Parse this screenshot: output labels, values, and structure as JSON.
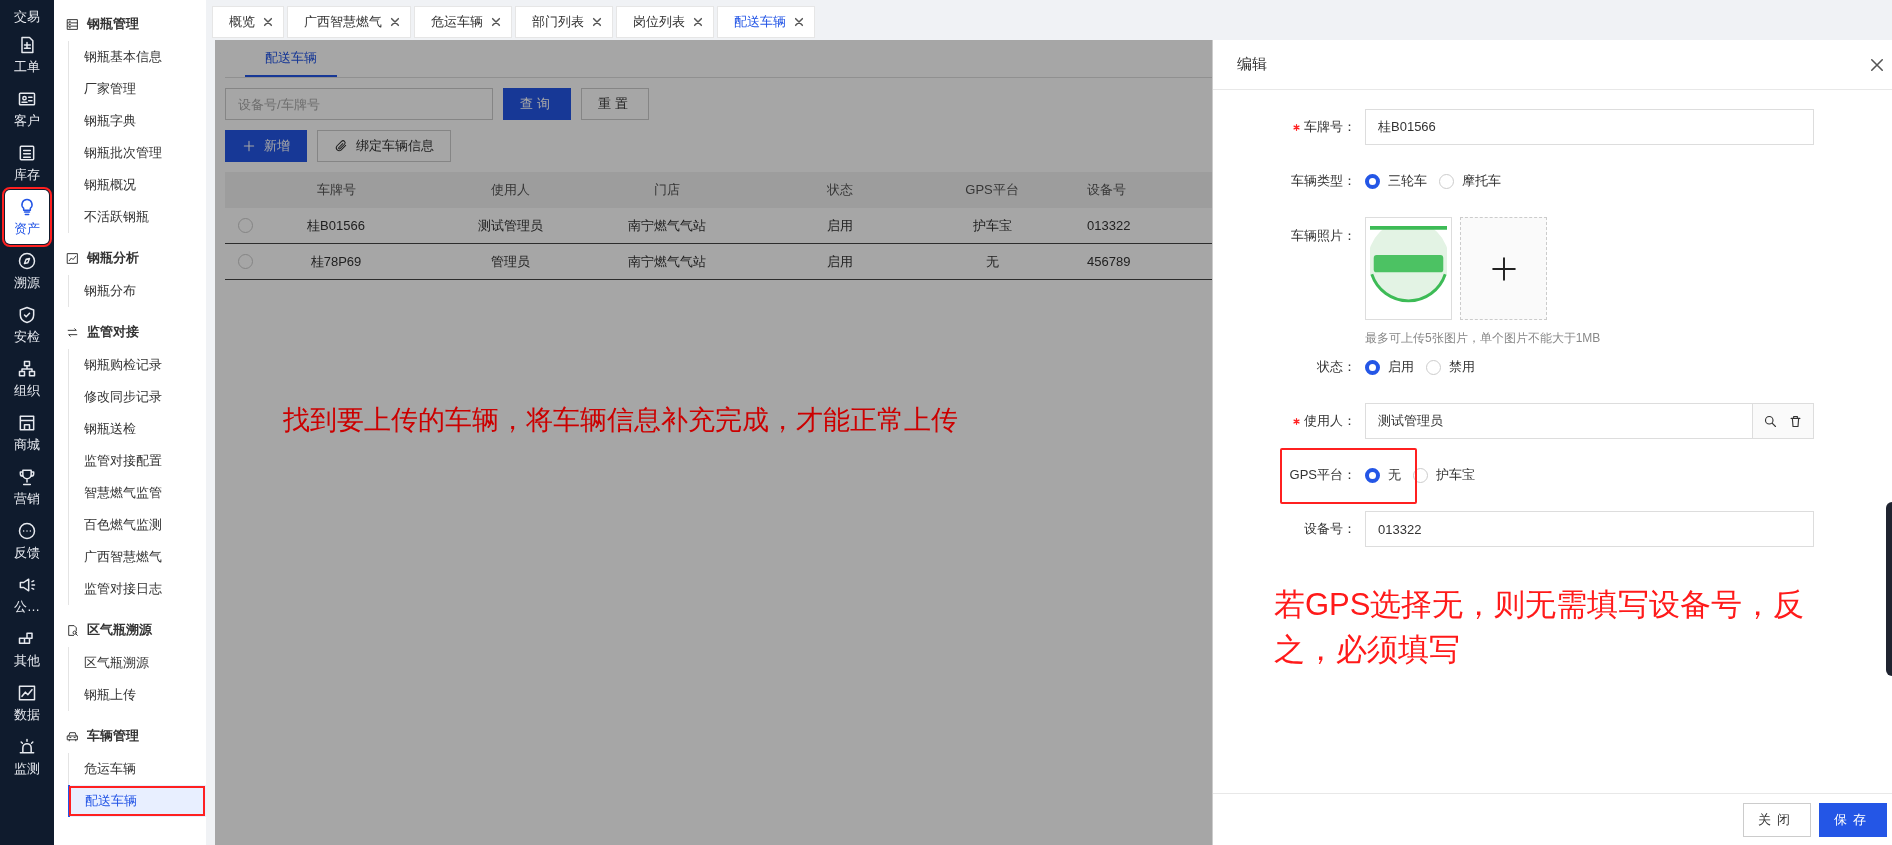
{
  "nav_rail": {
    "items": [
      {
        "label": "交易",
        "selected": false,
        "outlined": false
      },
      {
        "label": "工单",
        "selected": false,
        "outlined": false
      },
      {
        "label": "客户",
        "selected": false,
        "outlined": false
      },
      {
        "label": "库存",
        "selected": false,
        "outlined": false
      },
      {
        "label": "资产",
        "selected": true,
        "outlined": true
      },
      {
        "label": "溯源",
        "selected": false,
        "outlined": false
      },
      {
        "label": "安检",
        "selected": false,
        "outlined": false
      },
      {
        "label": "组织",
        "selected": false,
        "outlined": false
      },
      {
        "label": "商城",
        "selected": false,
        "outlined": false
      },
      {
        "label": "营销",
        "selected": false,
        "outlined": false
      },
      {
        "label": "反馈",
        "selected": false,
        "outlined": false
      },
      {
        "label": "公…",
        "selected": false,
        "outlined": false
      },
      {
        "label": "其他",
        "selected": false,
        "outlined": false
      },
      {
        "label": "数据",
        "selected": false,
        "outlined": false
      },
      {
        "label": "监测",
        "selected": false,
        "outlined": false
      }
    ]
  },
  "sidebar": {
    "groups": [
      {
        "title": "钢瓶管理",
        "items": [
          {
            "label": "钢瓶基本信息",
            "selected": false,
            "outlined": false
          },
          {
            "label": "厂家管理",
            "selected": false,
            "outlined": false
          },
          {
            "label": "钢瓶字典",
            "selected": false,
            "outlined": false
          },
          {
            "label": "钢瓶批次管理",
            "selected": false,
            "outlined": false
          },
          {
            "label": "钢瓶概况",
            "selected": false,
            "outlined": false
          },
          {
            "label": "不活跃钢瓶",
            "selected": false,
            "outlined": false
          }
        ]
      },
      {
        "title": "钢瓶分析",
        "items": [
          {
            "label": "钢瓶分布",
            "selected": false,
            "outlined": false
          }
        ]
      },
      {
        "title": "监管对接",
        "items": [
          {
            "label": "钢瓶购检记录",
            "selected": false,
            "outlined": false
          },
          {
            "label": "修改同步记录",
            "selected": false,
            "outlined": false
          },
          {
            "label": "钢瓶送检",
            "selected": false,
            "outlined": false
          },
          {
            "label": "监管对接配置",
            "selected": false,
            "outlined": false
          },
          {
            "label": "智慧燃气监管",
            "selected": false,
            "outlined": false
          },
          {
            "label": "百色燃气监测",
            "selected": false,
            "outlined": false
          },
          {
            "label": "广西智慧燃气",
            "selected": false,
            "outlined": false
          },
          {
            "label": "监管对接日志",
            "selected": false,
            "outlined": false
          }
        ]
      },
      {
        "title": "区气瓶溯源",
        "items": [
          {
            "label": "区气瓶溯源",
            "selected": false,
            "outlined": false
          },
          {
            "label": "钢瓶上传",
            "selected": false,
            "outlined": false
          }
        ]
      },
      {
        "title": "车辆管理",
        "items": [
          {
            "label": "危运车辆",
            "selected": false,
            "outlined": false
          },
          {
            "label": "配送车辆",
            "selected": true,
            "outlined": true
          }
        ]
      }
    ]
  },
  "tabs": [
    {
      "label": "概览",
      "selected": false
    },
    {
      "label": "广西智慧燃气",
      "selected": false
    },
    {
      "label": "危运车辆",
      "selected": false
    },
    {
      "label": "部门列表",
      "selected": false
    },
    {
      "label": "岗位列表",
      "selected": false
    },
    {
      "label": "配送车辆",
      "selected": true
    }
  ],
  "page": {
    "subtabs": [
      {
        "label": "配送车辆",
        "selected": true
      }
    ],
    "search": {
      "placeholder": "设备号/车牌号"
    },
    "buttons": [
      {
        "label": "查询",
        "kind": "primary"
      },
      {
        "label": "重置",
        "kind": "default"
      }
    ],
    "actions": [
      {
        "label": "新增",
        "kind": "primary"
      },
      {
        "label": "绑定车辆信息",
        "kind": "default"
      }
    ],
    "table": {
      "columns": [
        "车牌号",
        "使用人",
        "门店",
        "状态",
        "GPS平台",
        "设备号"
      ],
      "rows": [
        {
          "selected": false,
          "cells": [
            "桂B01566",
            "测试管理员",
            "南宁燃气气站",
            "启用",
            "护车宝",
            "013322"
          ]
        },
        {
          "selected": false,
          "cells": [
            "桂78P69",
            "管理员",
            "南宁燃气气站",
            "启用",
            "无",
            "456789"
          ]
        }
      ]
    },
    "annotation": "找到要上传的车辆，将车辆信息补充完成，才能正常上传"
  },
  "drawer": {
    "title": "编辑",
    "fields": [
      {
        "kind": "text",
        "label": "车牌号：",
        "required": true,
        "value": "桂B01566"
      },
      {
        "kind": "radio",
        "label": "车辆类型：",
        "options": [
          {
            "label": "三轮车",
            "selected": true
          },
          {
            "label": "摩托车",
            "selected": false
          }
        ]
      },
      {
        "kind": "upload",
        "label": "车辆照片：",
        "hint": "最多可上传5张图片，单个图片不能大于1MB"
      },
      {
        "kind": "radio",
        "label": "状态：",
        "options": [
          {
            "label": "启用",
            "selected": true
          },
          {
            "label": "禁用",
            "selected": false
          }
        ]
      },
      {
        "kind": "lookup",
        "label": "使用人：",
        "required": true,
        "value": "测试管理员"
      },
      {
        "kind": "radio",
        "label": "GPS平台：",
        "outlined": true,
        "options": [
          {
            "label": "无",
            "selected": true
          },
          {
            "label": "护车宝",
            "selected": false
          }
        ]
      },
      {
        "kind": "text",
        "label": "设备号：",
        "required": false,
        "value": "013322"
      }
    ],
    "annotation": "若GPS选择无，则无需填写设备号，反之，必须填写",
    "buttons": [
      {
        "label": "关闭",
        "kind": "default"
      },
      {
        "label": "保存",
        "kind": "primary"
      }
    ]
  }
}
